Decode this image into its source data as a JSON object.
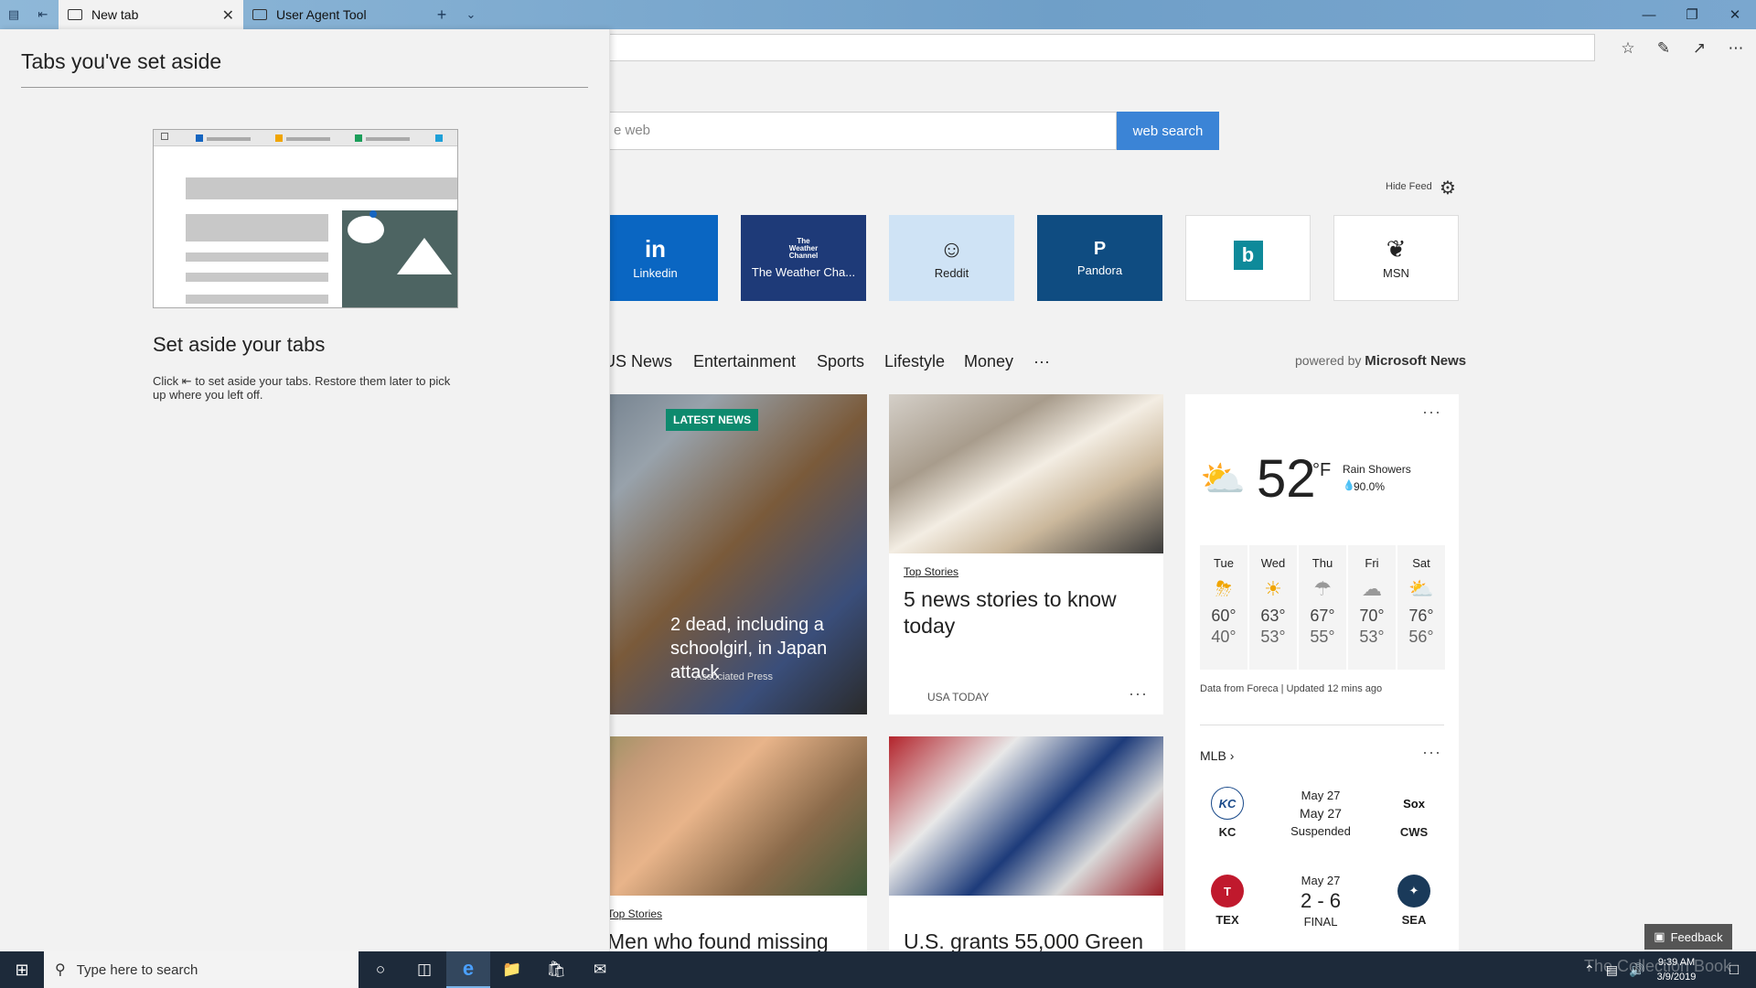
{
  "tabs": [
    {
      "title": "New tab"
    },
    {
      "title": "User Agent Tool"
    }
  ],
  "panel": {
    "title": "Tabs you've set aside",
    "heading": "Set aside your tabs",
    "desc_before": "Click",
    "desc_after": "to set aside your tabs. Restore them later to pick up where you left off."
  },
  "search": {
    "placeholder_partial": "e web",
    "button": "web search"
  },
  "feed": {
    "hide_label": "Hide Feed"
  },
  "sites": [
    {
      "label": "Linkedin",
      "logo": "in",
      "color": "#0a66c2",
      "text_color": "#ffffff"
    },
    {
      "label": "The Weather Cha...",
      "logo": "The Weather Channel",
      "color": "#1e3a78",
      "text_color": "#ffffff"
    },
    {
      "label": "Reddit",
      "logo": "reddit-alien-icon",
      "color": "#cfe3f5",
      "text_color": "#222222"
    },
    {
      "label": "Pandora",
      "logo": "P",
      "color": "#0f4c81",
      "text_color": "#ffffff"
    },
    {
      "label": "",
      "logo": "bing-icon",
      "color": "#ffffff",
      "text_color": "#0e7a8a"
    },
    {
      "label": "MSN",
      "logo": "msn-butterfly-icon",
      "color": "#ffffff",
      "text_color": "#222222"
    }
  ],
  "categories": [
    "US News",
    "Entertainment",
    "Sports",
    "Lifestyle",
    "Money",
    "···"
  ],
  "powered": {
    "prefix": "powered by",
    "brand": "Microsoft News"
  },
  "news": {
    "hero": {
      "badge": "LATEST NEWS",
      "title": "2 dead, including a schoolgirl, in Japan attack",
      "source": "Associated Press"
    },
    "card2": {
      "tag": "Top Stories",
      "title": "5 news stories to know today",
      "source": "USA TODAY"
    },
    "card3": {
      "tag": "Top Stories",
      "title": "Men who found missing"
    },
    "card4": {
      "title": "U.S. grants 55,000 Green"
    }
  },
  "weather": {
    "temp": "52",
    "unit": "°F",
    "condition": "Rain Showers",
    "precip": "90.0%",
    "days": [
      {
        "name": "Tue",
        "hi": "60°",
        "lo": "40°",
        "icon": "storm-icon"
      },
      {
        "name": "Wed",
        "hi": "63°",
        "lo": "53°",
        "icon": "sunny-icon"
      },
      {
        "name": "Thu",
        "hi": "67°",
        "lo": "55°",
        "icon": "rain-icon"
      },
      {
        "name": "Fri",
        "hi": "70°",
        "lo": "53°",
        "icon": "cloudy-icon"
      },
      {
        "name": "Sat",
        "hi": "76°",
        "lo": "56°",
        "icon": "partly-sunny-icon"
      }
    ],
    "source": "Data from Foreca | Updated 12 mins ago"
  },
  "mlb": {
    "title": "MLB",
    "games": [
      {
        "away": "KC",
        "home": "CWS",
        "date": "May 27",
        "line2": "May 27",
        "status": "Suspended"
      },
      {
        "away": "TEX",
        "home": "SEA",
        "date": "May 27",
        "line2": "2 - 6",
        "status": "FINAL"
      }
    ]
  },
  "feedback": "Feedback",
  "taskbar": {
    "search_placeholder": "Type here to search",
    "time": "9:39 AM",
    "date": "3/9/2019",
    "watermark": "The Collection Book"
  }
}
